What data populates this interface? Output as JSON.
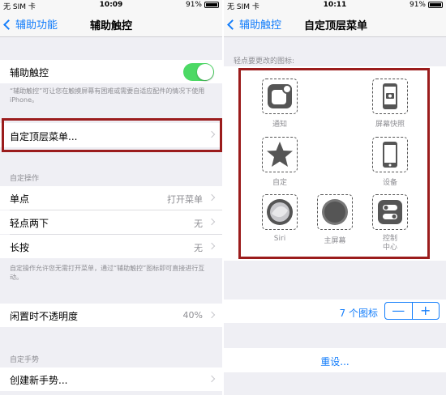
{
  "left": {
    "status": {
      "carrier": "无 SIM 卡",
      "time": "10:09",
      "battery": "91%"
    },
    "nav": {
      "back_label": "辅助功能",
      "title": "辅助触控"
    },
    "assistive_touch": {
      "label": "辅助触控",
      "footnote": "“辅助触控”可让您在触摸屏幕有困难或需要自适应配件的情况下使用 iPhone。"
    },
    "customize_menu": {
      "label": "自定顶层菜单..."
    },
    "custom_actions": {
      "header": "自定操作",
      "rows": [
        {
          "label": "单点",
          "value": "打开菜单"
        },
        {
          "label": "轻点两下",
          "value": "无"
        },
        {
          "label": "长按",
          "value": "无"
        }
      ],
      "footnote": "自定操作允许您无需打开菜单，通过“辅助触控”图标即可直接进行互动。"
    },
    "idle_opacity": {
      "label": "闲置时不透明度",
      "value": "40%"
    },
    "custom_gestures": {
      "header": "自定手势",
      "create_label": "创建新手势..."
    }
  },
  "right": {
    "status": {
      "carrier": "无 SIM 卡",
      "time": "10:11",
      "battery": "91%"
    },
    "nav": {
      "back_label": "辅助触控",
      "title": "自定顶层菜单"
    },
    "hint": "轻点要更改的图标:",
    "icons": {
      "notification": "通知",
      "screenshot": "屏幕快照",
      "custom": "自定",
      "device": "设备",
      "siri": "Siri",
      "home": "主屏幕",
      "control_center": "控制\n中心"
    },
    "icon_count": "7 个图标",
    "stepper": {
      "minus": "—",
      "plus": "+"
    },
    "reset_label": "重设..."
  },
  "colors": {
    "accent": "#147efb",
    "toggle_on": "#4cd964",
    "highlight": "#9b1c1c"
  }
}
